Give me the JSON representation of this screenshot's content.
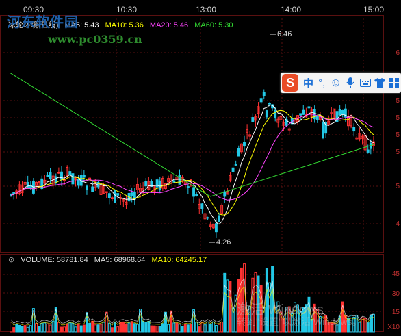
{
  "time_axis": {
    "labels": [
      "09:30",
      "10:30",
      "13:00",
      "14:00",
      "15:00"
    ]
  },
  "watermark": {
    "site": "河东软件园",
    "url": "www.pc0359.cn"
  },
  "price_panel": {
    "stock_name": "冰轮环境(日线)",
    "legend": [
      {
        "label": "MA5: 5.43",
        "color": "#ffffff"
      },
      {
        "label": "MA10: 5.36",
        "color": "#ffff00"
      },
      {
        "label": "MA20: 5.46",
        "color": "#ff44ff"
      },
      {
        "label": "MA60: 5.30",
        "color": "#33dd33"
      }
    ],
    "high_label": "6.46",
    "low_label": "4.26",
    "axis_labels": [
      "6",
      "5",
      "5",
      "5",
      "5",
      "5",
      "4"
    ]
  },
  "volume_panel": {
    "legend": [
      {
        "label": "VOLUME: 58781.84",
        "color": "#dddddd"
      },
      {
        "label": "MA5: 68968.64",
        "color": "#dddddd"
      },
      {
        "label": "MA10: 64245.17",
        "color": "#ffff00"
      }
    ],
    "axis_labels": [
      "45",
      "30",
      "15",
      "X10"
    ]
  },
  "ime_toolbar": {
    "logo": "S",
    "items": [
      "中",
      "°,",
      "☺",
      "mic",
      "keyboard",
      "shirt",
      "grid"
    ]
  },
  "os_watermark": {
    "line1": "激活 Windows",
    "line2": "转到\"设置\"以激活 Windows。"
  },
  "colors": {
    "up": "#ff3232",
    "down": "#22c8e6",
    "bg": "#000000",
    "grid": "#5a1010"
  }
}
